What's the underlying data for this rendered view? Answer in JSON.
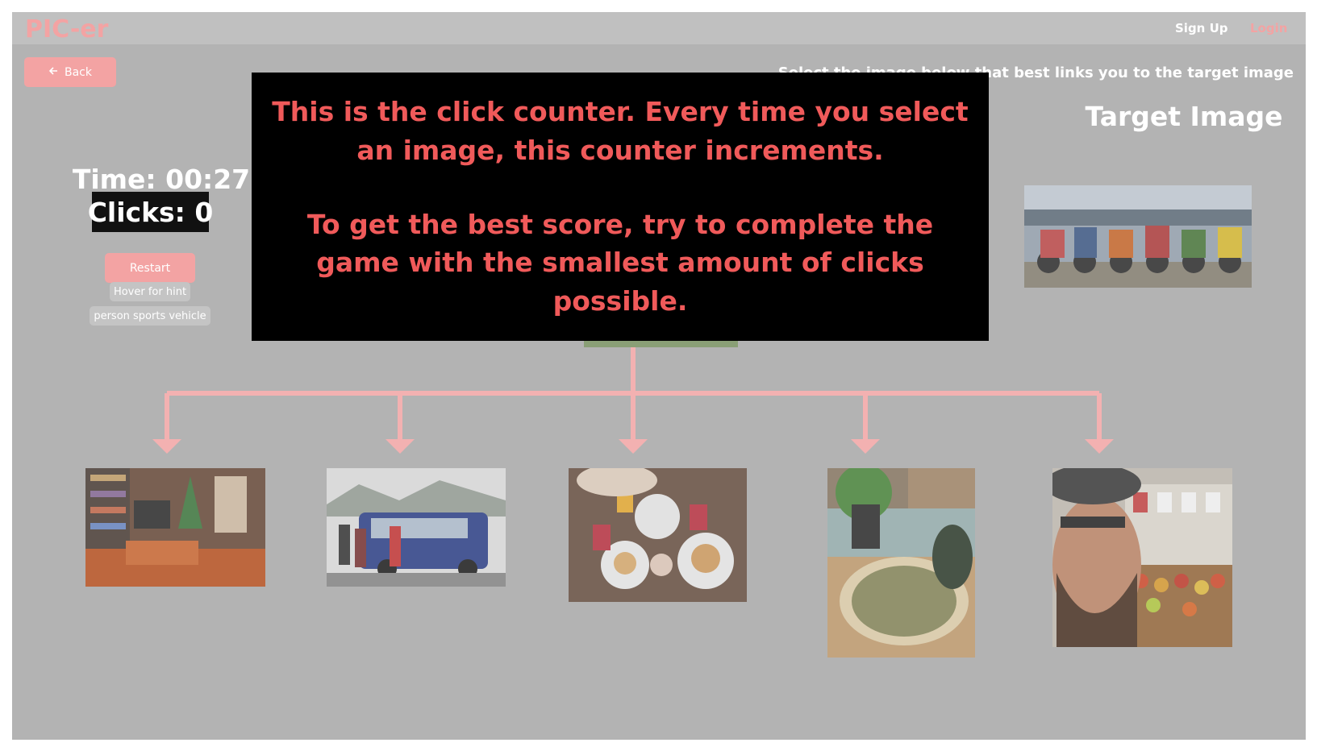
{
  "app": {
    "logo": "PIC-er"
  },
  "nav": {
    "signup": "Sign Up",
    "login": "Login"
  },
  "toolbar": {
    "back_label": "Back"
  },
  "game": {
    "instruction": "Select the image below that best links you to the target image",
    "target_title": "Target Image",
    "time": "Time: 00:27",
    "clicks": "Clicks: 0",
    "restart_label": "Restart",
    "hint_label": "Hover for hint",
    "hint_text": "person sports vehicle"
  },
  "tutorial": {
    "line1": "This is the click counter. Every time you select an image, this counter increments.",
    "line2": "To get the best score, try to complete the game with the smallest amount of clicks possible."
  },
  "colors": {
    "accent": "#f3a3a3",
    "overlay_text": "#f05a5a",
    "dim_background": "#b3b3b3"
  },
  "choices": [
    {
      "subject": "living room with christmas tree"
    },
    {
      "subject": "people boarding a bus in snow"
    },
    {
      "subject": "breakfast table with plates and drinks"
    },
    {
      "subject": "pizza on wooden board with plant"
    },
    {
      "subject": "man selfie at fruit market"
    }
  ],
  "target": {
    "subject": "row of motocross bikes and riders"
  }
}
